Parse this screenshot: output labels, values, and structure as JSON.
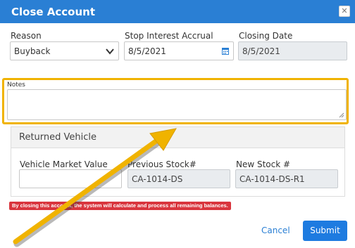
{
  "dialog": {
    "title": "Close Account",
    "close_glyph": "✕"
  },
  "reason": {
    "label": "Reason",
    "value": "Buyback"
  },
  "stop_interest": {
    "label": "Stop Interest Accrual",
    "value": "8/5/2021"
  },
  "closing_date": {
    "label": "Closing Date",
    "value": "8/5/2021"
  },
  "notes": {
    "label": "Notes",
    "value": ""
  },
  "returned_vehicle": {
    "title": "Returned Vehicle",
    "market_value_label": "Vehicle Market Value",
    "market_value": "",
    "previous_stock_label": "Previous Stock#",
    "previous_stock": "CA-1014-DS",
    "new_stock_label": "New Stock #",
    "new_stock": "CA-1014-DS-R1"
  },
  "warning": {
    "text": "By closing this account, the system will calculate and process all remaining balances."
  },
  "actions": {
    "cancel_label": "Cancel",
    "submit_label": "Submit"
  },
  "colors": {
    "titlebar": "#2a7fd4",
    "highlight": "#f0b300",
    "warning": "#d9363e",
    "submit": "#1e7be0"
  },
  "icons": {
    "close": "close-icon",
    "dropdown": "chevron-down-icon",
    "calendar": "calendar-icon",
    "annotation": "arrow-annotation"
  }
}
